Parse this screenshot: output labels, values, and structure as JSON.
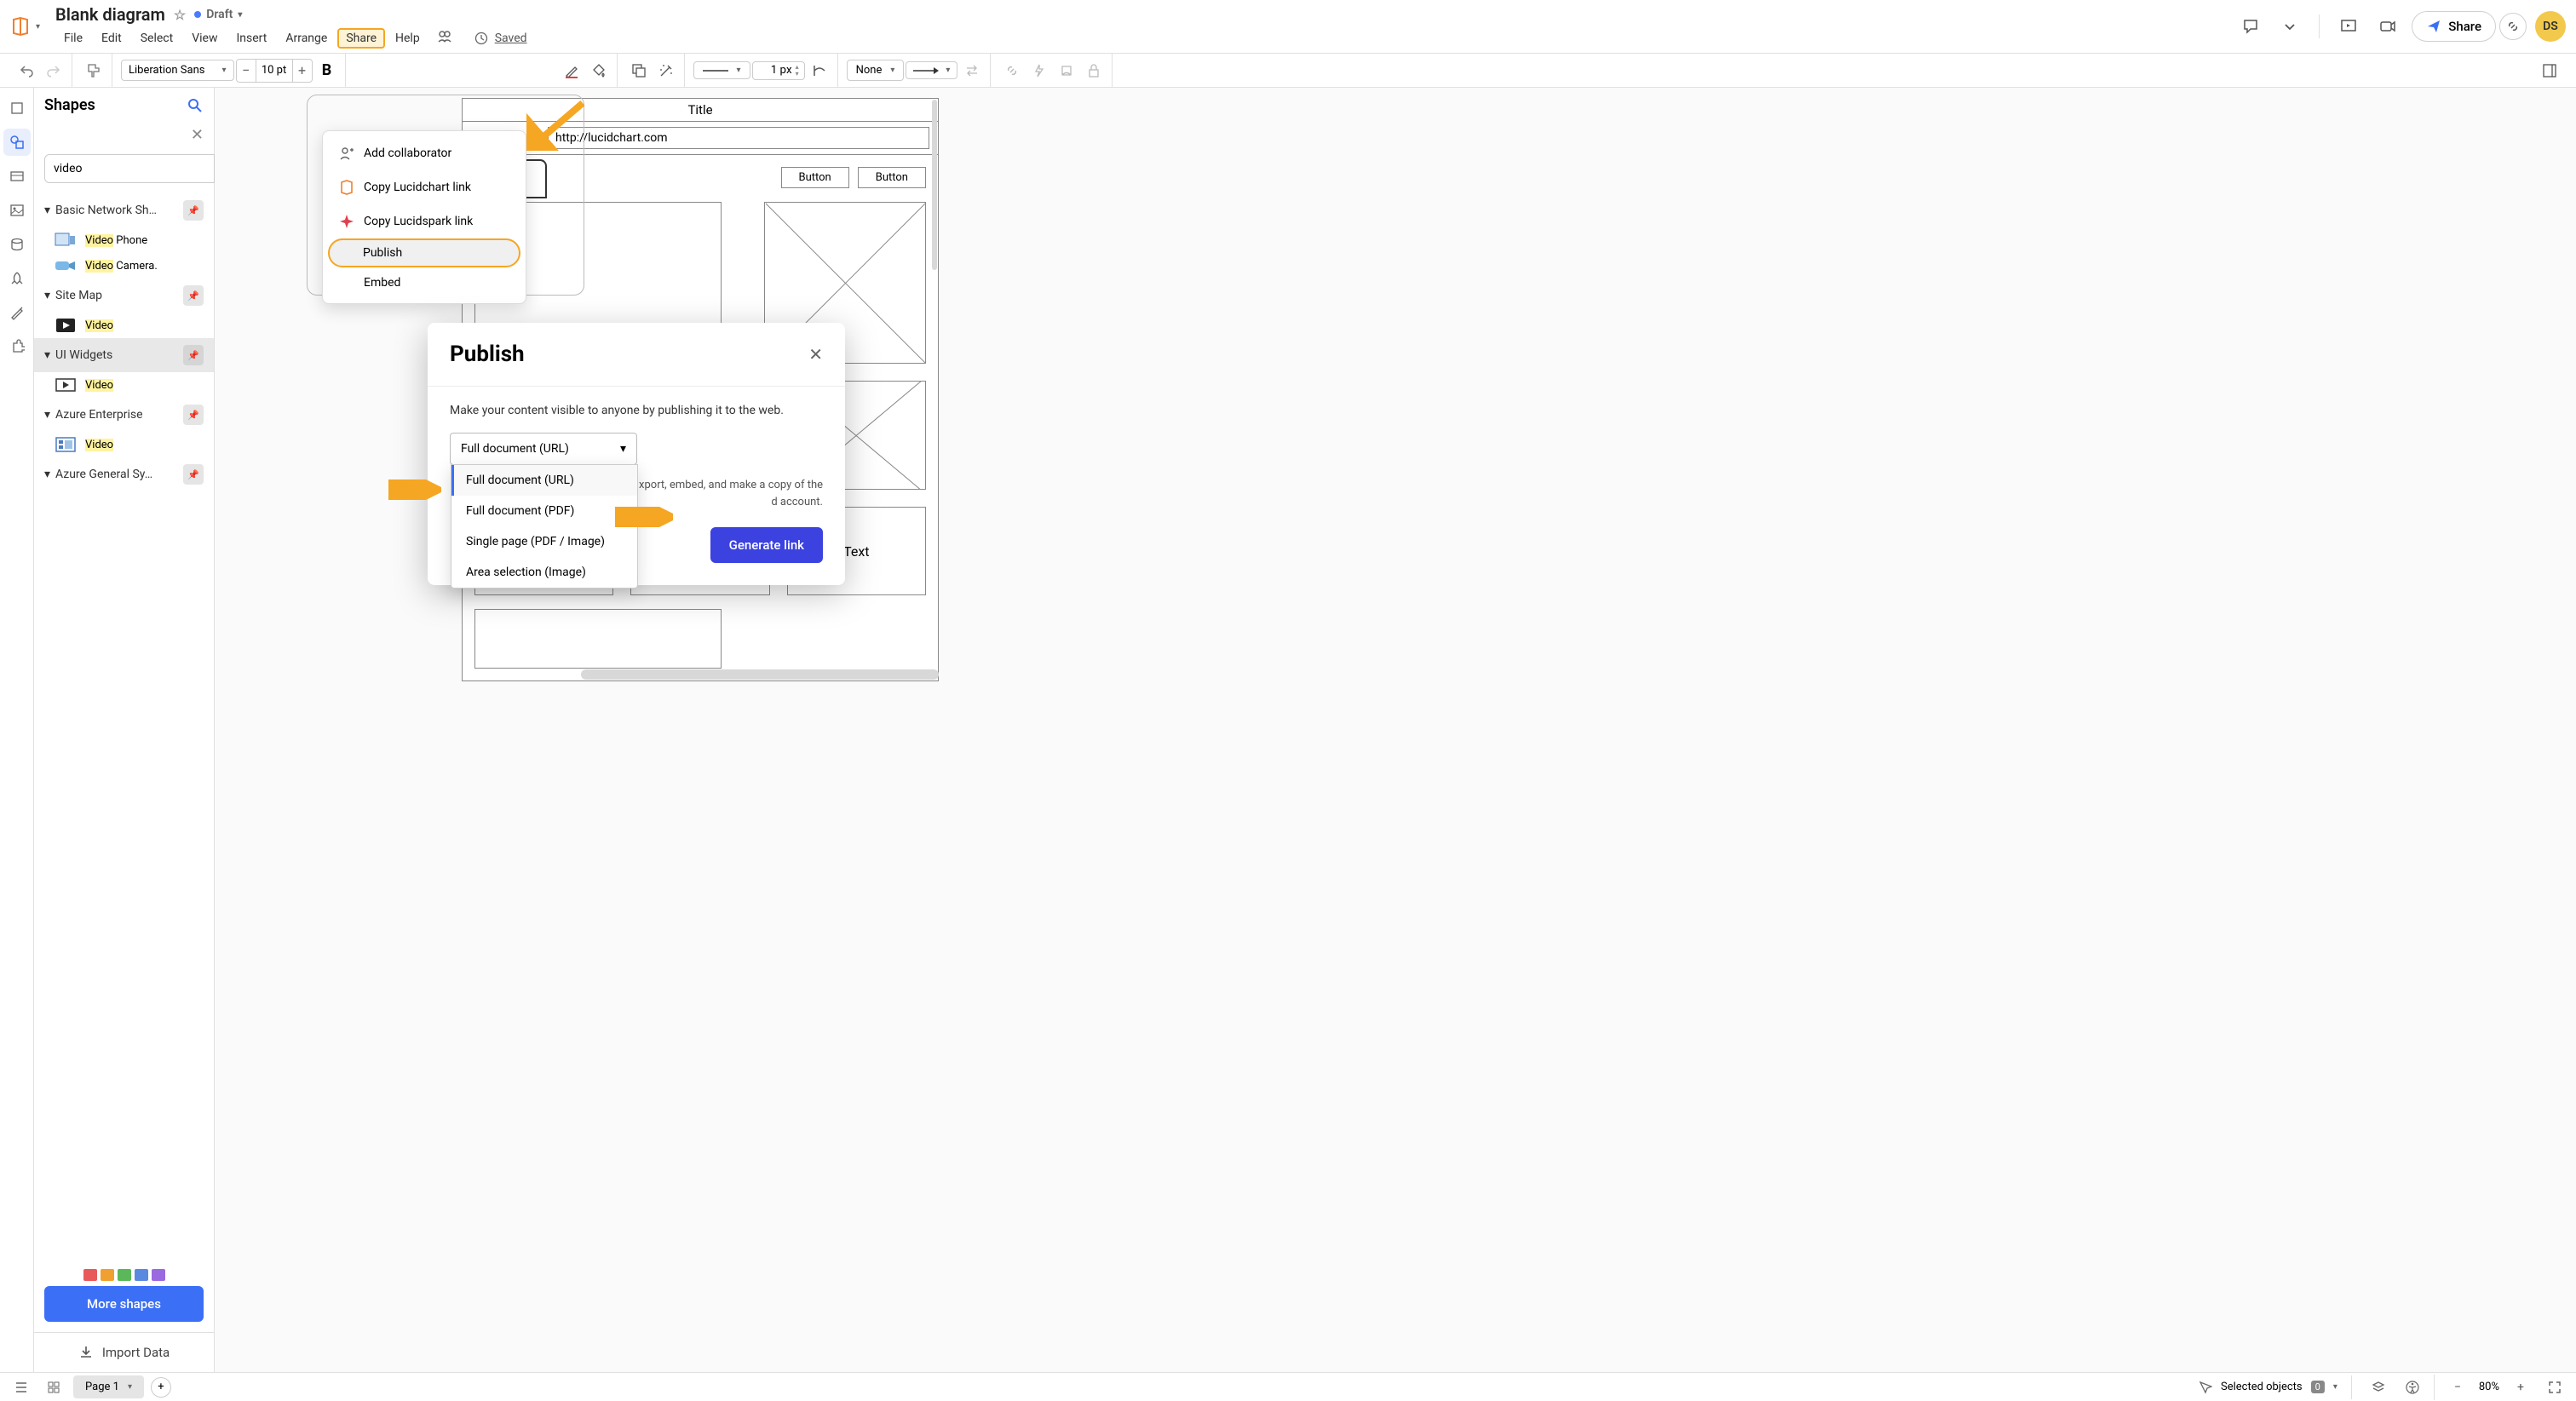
{
  "header": {
    "doc_title": "Blank diagram",
    "draft_label": "Draft",
    "saved_label": "Saved",
    "share_btn": "Share",
    "avatar_initials": "DS"
  },
  "menu": {
    "items": [
      "File",
      "Edit",
      "Select",
      "View",
      "Insert",
      "Arrange",
      "Share",
      "Help"
    ]
  },
  "toolbar": {
    "font": "Liberation Sans",
    "size": "10 pt",
    "line_weight": "1 px",
    "fill": "None"
  },
  "shapes": {
    "title": "Shapes",
    "search_value": "video",
    "categories": [
      {
        "name": "Basic Network Sh…",
        "items": [
          {
            "label_pre": "Video",
            "label_post": " Phone"
          },
          {
            "label_pre": "Video",
            "label_post": " Camera."
          }
        ]
      },
      {
        "name": "Site Map",
        "items": [
          {
            "label_pre": "Video",
            "label_post": ""
          }
        ]
      },
      {
        "name": "UI Widgets",
        "selected": true,
        "items": [
          {
            "label_pre": "Video",
            "label_post": ""
          }
        ]
      },
      {
        "name": "Azure Enterprise",
        "items": [
          {
            "label_pre": "Video",
            "label_post": ""
          }
        ]
      },
      {
        "name": "Azure General Sy…",
        "items": []
      }
    ],
    "more_btn": "More shapes",
    "import_label": "Import Data"
  },
  "share_dropdown": {
    "items": [
      {
        "label": "Add collaborator",
        "icon": "person-plus"
      },
      {
        "label": "Copy Lucidchart link",
        "icon": "lucid-orange"
      },
      {
        "label": "Copy Lucidspark link",
        "icon": "spark-red"
      },
      {
        "label": "Publish",
        "icon": "",
        "highlighted": true
      },
      {
        "label": "Embed",
        "icon": ""
      }
    ]
  },
  "publish_dialog": {
    "title": "Publish",
    "desc": "Make your content visible to anyone by publishing it to the web.",
    "selected_format": "Full document (URL)",
    "format_options": [
      "Full document (URL)",
      "Full document (PDF)",
      "Single page (PDF / Image)",
      "Area selection (Image)"
    ],
    "hint_partial": "xport, embed, and make a copy of the",
    "hint_partial2": "d account.",
    "generate_btn": "Generate link"
  },
  "canvas": {
    "title": "Title",
    "url": "http://lucidchart.com",
    "button_label": "Button",
    "text_label": "Text"
  },
  "footer": {
    "page_label": "Page 1",
    "selected_label": "Selected objects",
    "selected_count": "0",
    "zoom": "80%"
  }
}
